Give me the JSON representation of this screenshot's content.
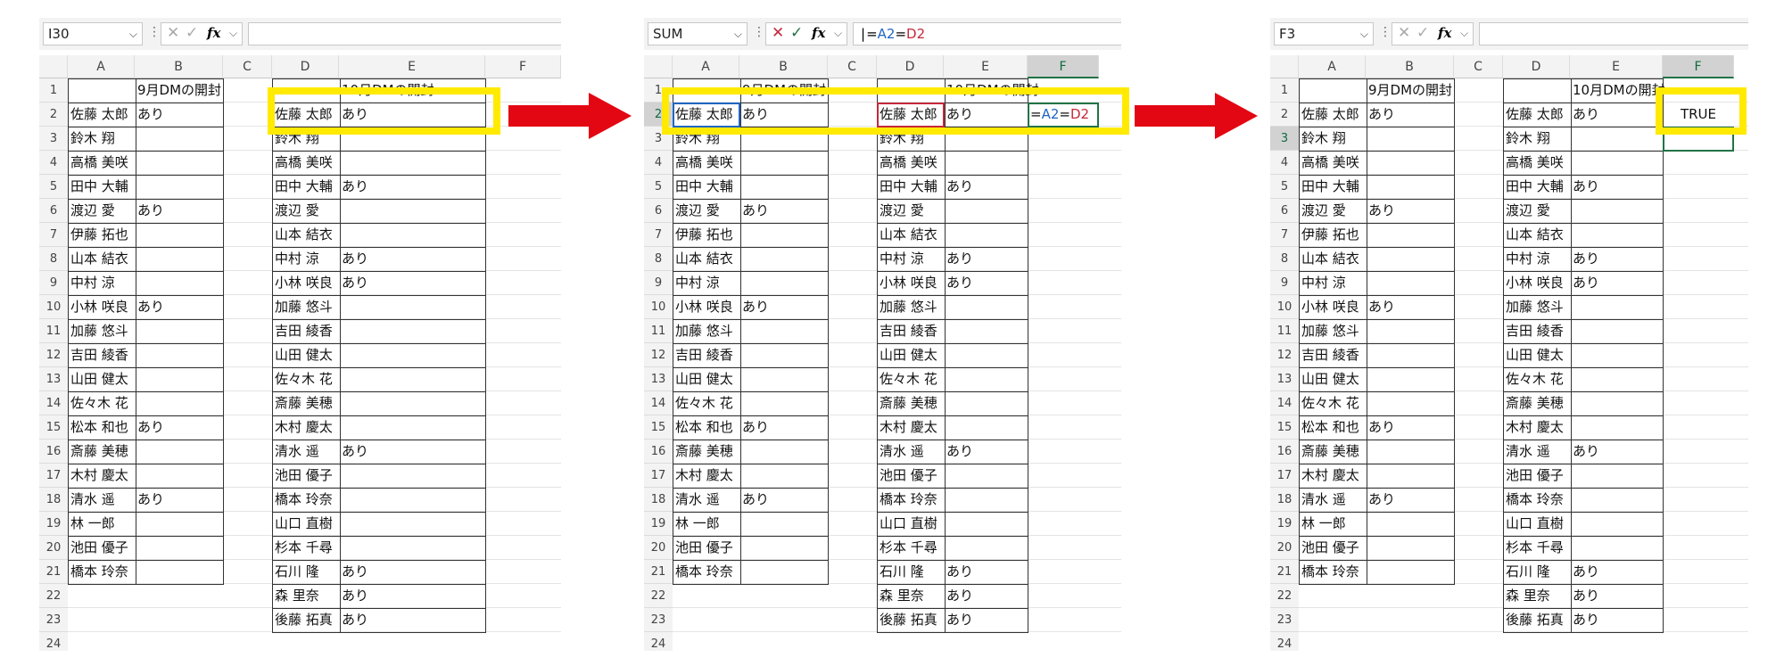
{
  "panels": [
    {
      "name_box": "I30",
      "formula": "",
      "col_a": [
        "",
        "佐藤 太郎",
        "鈴木 翔",
        "高橋 美咲",
        "田中 大輔",
        "渡辺 愛",
        "伊藤 拓也",
        "山本 結衣",
        "中村 涼",
        "小林 咲良",
        "加藤 悠斗",
        "吉田 綾香",
        "山田 健太",
        "佐々木 花",
        "松本 和也",
        "斎藤 美穂",
        "木村 慶太",
        "清水 遥",
        "林 一郎",
        "池田 優子",
        "橋本 玲奈"
      ],
      "col_b": [
        "9月DMの開封",
        "あり",
        "",
        "",
        "",
        "あり",
        "",
        "",
        "",
        "あり",
        "",
        "",
        "",
        "",
        "あり",
        "",
        "",
        "あり",
        "",
        "",
        ""
      ],
      "col_d": [
        "",
        "佐藤 太郎",
        "鈴木 翔",
        "高橋 美咲",
        "田中 大輔",
        "渡辺 愛",
        "山本 結衣",
        "中村 涼",
        "小林 咲良",
        "加藤 悠斗",
        "吉田 綾香",
        "山田 健太",
        "佐々木 花",
        "斎藤 美穂",
        "木村 慶太",
        "清水 遥",
        "池田 優子",
        "橋本 玲奈",
        "山口 直樹",
        "杉本 千尋",
        "石川 隆",
        "森 里奈",
        "後藤 拓真"
      ],
      "col_e": [
        "10月DMの開封",
        "あり",
        "",
        "",
        "あり",
        "",
        "",
        "あり",
        "あり",
        "",
        "",
        "",
        "",
        "",
        "",
        "あり",
        "",
        "",
        "",
        "",
        "あり",
        "あり",
        "あり"
      ],
      "col_f": [
        "",
        "",
        "",
        "",
        "",
        "",
        "",
        "",
        "",
        "",
        "",
        "",
        "",
        "",
        "",
        "",
        "",
        "",
        "",
        "",
        "",
        "",
        ""
      ]
    },
    {
      "name_box": "SUM",
      "formula": "=A2=D2",
      "col_a": [
        "",
        "佐藤 太郎",
        "鈴木 翔",
        "高橋 美咲",
        "田中 大輔",
        "渡辺 愛",
        "伊藤 拓也",
        "山本 結衣",
        "中村 涼",
        "小林 咲良",
        "加藤 悠斗",
        "吉田 綾香",
        "山田 健太",
        "佐々木 花",
        "松本 和也",
        "斎藤 美穂",
        "木村 慶太",
        "清水 遥",
        "林 一郎",
        "池田 優子",
        "橋本 玲奈"
      ],
      "col_b": [
        "9月DMの開封",
        "あり",
        "",
        "",
        "",
        "あり",
        "",
        "",
        "",
        "あり",
        "",
        "",
        "",
        "",
        "あり",
        "",
        "",
        "あり",
        "",
        "",
        ""
      ],
      "col_d": [
        "",
        "佐藤 太郎",
        "鈴木 翔",
        "高橋 美咲",
        "田中 大輔",
        "渡辺 愛",
        "山本 結衣",
        "中村 涼",
        "小林 咲良",
        "加藤 悠斗",
        "吉田 綾香",
        "山田 健太",
        "佐々木 花",
        "斎藤 美穂",
        "木村 慶太",
        "清水 遥",
        "池田 優子",
        "橋本 玲奈",
        "山口 直樹",
        "杉本 千尋",
        "石川 隆",
        "森 里奈",
        "後藤 拓真"
      ],
      "col_e": [
        "10月DMの開封",
        "あり",
        "",
        "",
        "あり",
        "",
        "",
        "あり",
        "あり",
        "",
        "",
        "",
        "",
        "",
        "",
        "あり",
        "",
        "",
        "",
        "",
        "あり",
        "あり",
        "あり"
      ],
      "col_f": [
        "",
        "=A2=D2",
        "",
        "",
        "",
        "",
        "",
        "",
        "",
        "",
        "",
        "",
        "",
        "",
        "",
        "",
        "",
        "",
        "",
        "",
        "",
        "",
        ""
      ]
    },
    {
      "name_box": "F3",
      "formula": "",
      "col_a": [
        "",
        "佐藤 太郎",
        "鈴木 翔",
        "高橋 美咲",
        "田中 大輔",
        "渡辺 愛",
        "伊藤 拓也",
        "山本 結衣",
        "中村 涼",
        "小林 咲良",
        "加藤 悠斗",
        "吉田 綾香",
        "山田 健太",
        "佐々木 花",
        "松本 和也",
        "斎藤 美穂",
        "木村 慶太",
        "清水 遥",
        "林 一郎",
        "池田 優子",
        "橋本 玲奈"
      ],
      "col_b": [
        "9月DMの開封",
        "あり",
        "",
        "",
        "",
        "あり",
        "",
        "",
        "",
        "あり",
        "",
        "",
        "",
        "",
        "あり",
        "",
        "",
        "あり",
        "",
        "",
        ""
      ],
      "col_d": [
        "",
        "佐藤 太郎",
        "鈴木 翔",
        "高橋 美咲",
        "田中 大輔",
        "渡辺 愛",
        "山本 結衣",
        "中村 涼",
        "小林 咲良",
        "加藤 悠斗",
        "吉田 綾香",
        "山田 健太",
        "佐々木 花",
        "斎藤 美穂",
        "木村 慶太",
        "清水 遥",
        "池田 優子",
        "橋本 玲奈",
        "山口 直樹",
        "杉本 千尋",
        "石川 隆",
        "森 里奈",
        "後藤 拓真"
      ],
      "col_e": [
        "10月DMの開封",
        "あり",
        "",
        "",
        "あり",
        "",
        "",
        "あり",
        "あり",
        "",
        "",
        "",
        "",
        "",
        "",
        "あり",
        "",
        "",
        "",
        "",
        "あり",
        "あり",
        "あり"
      ],
      "col_f": [
        "",
        "TRUE",
        "",
        "",
        "",
        "",
        "",
        "",
        "",
        "",
        "",
        "",
        "",
        "",
        "",
        "",
        "",
        "",
        "",
        "",
        "",
        "",
        ""
      ]
    }
  ],
  "column_letters": [
    "A",
    "B",
    "C",
    "D",
    "E",
    "F"
  ],
  "row_numbers": [
    "1",
    "2",
    "3",
    "4",
    "5",
    "6",
    "7",
    "8",
    "9",
    "10",
    "11",
    "12",
    "13",
    "14",
    "15",
    "16",
    "17",
    "18",
    "19",
    "20",
    "21",
    "22",
    "23",
    "24"
  ],
  "colors": {
    "highlight": "#ffea00",
    "arrow": "#e30613",
    "selection": "#217346"
  }
}
